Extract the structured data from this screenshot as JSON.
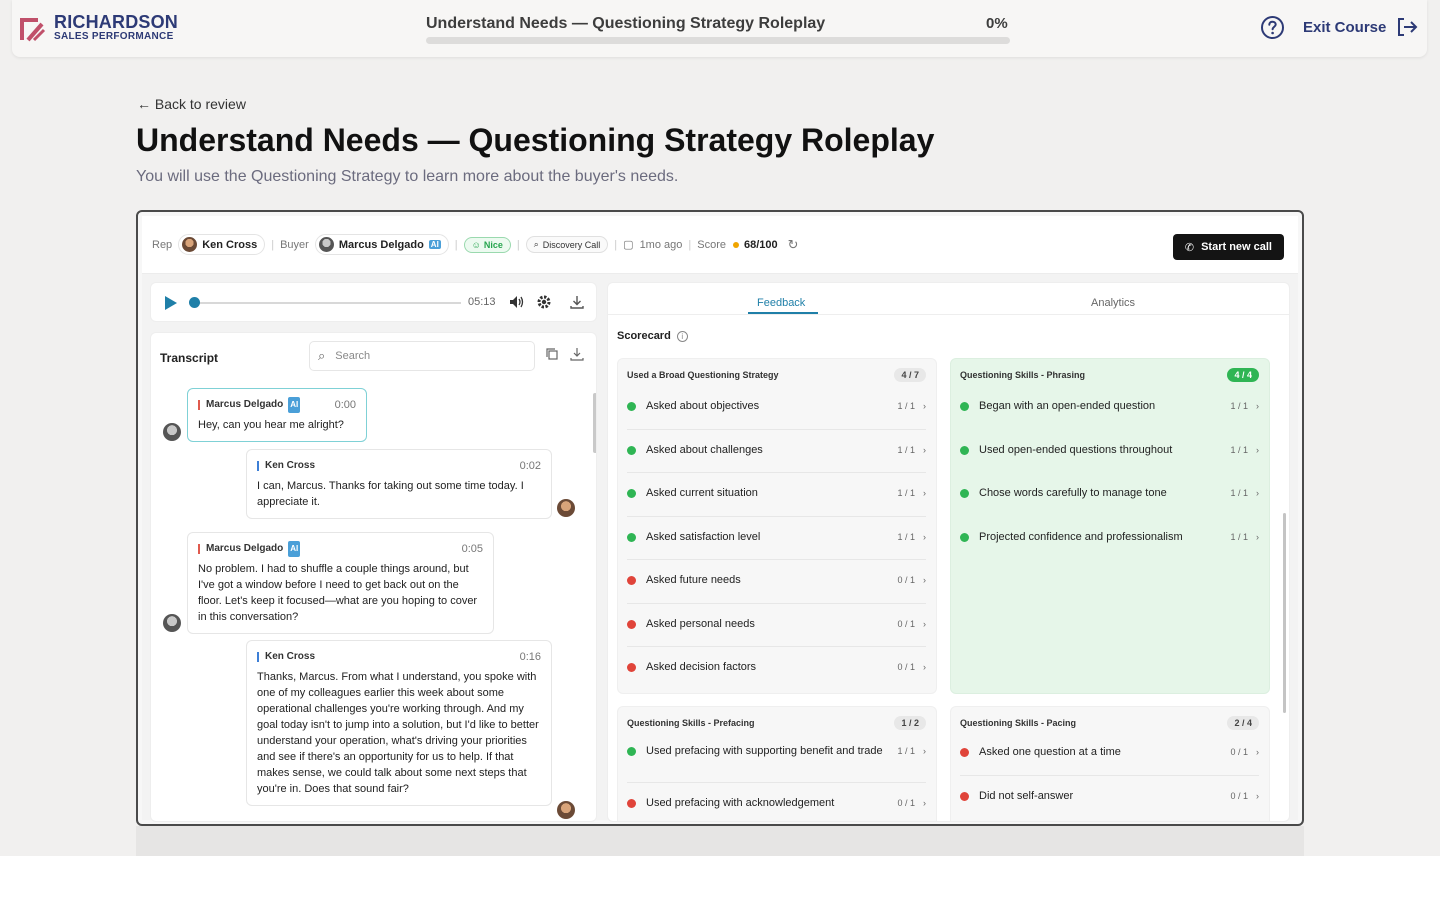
{
  "header": {
    "logo_line1": "RICHARDSON",
    "logo_line2": "SALES PERFORMANCE",
    "course_title": "Understand Needs — Questioning Strategy Roleplay",
    "progress_text": "0%",
    "progress_value": 0,
    "help_icon": "question-circle-icon",
    "exit_label": "Exit Course"
  },
  "page": {
    "back_label": "← Back to review",
    "title": "Understand Needs — Questioning Strategy Roleplay",
    "subtitle": "You will use the Questioning Strategy to learn more about the buyer's needs."
  },
  "callbar": {
    "rep_label": "Rep",
    "rep_name": "Ken Cross",
    "buyer_label": "Buyer",
    "buyer_name": "Marcus Delgado",
    "ai_badge": "AI",
    "nice_label": "Nice",
    "call_type": "Discovery Call",
    "time_ago": "1mo ago",
    "score_label": "Score",
    "score_value": "68/100",
    "start_label": "Start new call"
  },
  "player": {
    "duration": "05:13"
  },
  "transcript": {
    "title": "Transcript",
    "search_placeholder": "Search",
    "messages": [
      {
        "speaker": "Marcus Delgado",
        "ai": "AI",
        "time": "0:00",
        "text": "Hey, can you hear me alright?"
      },
      {
        "speaker": "Ken Cross",
        "time": "0:02",
        "text": "I can, Marcus. Thanks for taking out some time today. I appreciate it."
      },
      {
        "speaker": "Marcus Delgado",
        "ai": "AI",
        "time": "0:05",
        "text": "No problem. I had to shuffle a couple things around, but I've got a window before I need to get back out on the floor. Let's keep it focused—what are you hoping to cover in this conversation?"
      },
      {
        "speaker": "Ken Cross",
        "time": "0:16",
        "text": "Thanks, Marcus. From what I understand, you spoke with one of my colleagues earlier this week about some operational challenges you're working through. And my goal today isn't to jump into a solution, but I'd like to better understand your operation, what's driving your priorities and see if there's an opportunity for us to help. If that makes sense, we could talk about some next steps that you're in. Does that sound fair?"
      }
    ]
  },
  "feedback": {
    "tab_feedback": "Feedback",
    "tab_analytics": "Analytics",
    "scorecard_label": "Scorecard",
    "cards": [
      {
        "title": "Used a Broad Questioning Strategy",
        "score": "4 / 7",
        "items": [
          {
            "label": "Asked about objectives",
            "score": "1 / 1",
            "status": "pass"
          },
          {
            "label": "Asked about challenges",
            "score": "1 / 1",
            "status": "pass"
          },
          {
            "label": "Asked current situation",
            "score": "1 / 1",
            "status": "pass"
          },
          {
            "label": "Asked satisfaction level",
            "score": "1 / 1",
            "status": "pass"
          },
          {
            "label": "Asked future needs",
            "score": "0 / 1",
            "status": "fail"
          },
          {
            "label": "Asked personal needs",
            "score": "0 / 1",
            "status": "fail"
          },
          {
            "label": "Asked decision factors",
            "score": "0 / 1",
            "status": "fail"
          }
        ]
      },
      {
        "title": "Questioning Skills - Phrasing",
        "score": "4 / 4",
        "items": [
          {
            "label": "Began with an open-ended question",
            "score": "1 / 1",
            "status": "pass"
          },
          {
            "label": "Used open-ended questions throughout",
            "score": "1 / 1",
            "status": "pass"
          },
          {
            "label": "Chose words carefully to manage tone",
            "score": "1 / 1",
            "status": "pass"
          },
          {
            "label": "Projected confidence and professionalism",
            "score": "1 / 1",
            "status": "pass"
          }
        ]
      },
      {
        "title": "Questioning Skills - Prefacing",
        "score": "1 / 2",
        "items": [
          {
            "label": "Used prefacing with supporting benefit and trade",
            "score": "1 / 1",
            "status": "pass"
          },
          {
            "label": "Used prefacing with acknowledgement",
            "score": "0 / 1",
            "status": "fail"
          }
        ]
      },
      {
        "title": "Questioning Skills - Pacing",
        "score": "2 / 4",
        "items": [
          {
            "label": "Asked one question at a time",
            "score": "0 / 1",
            "status": "fail"
          },
          {
            "label": "Did not self-answer",
            "score": "0 / 1",
            "status": "fail"
          }
        ]
      }
    ]
  },
  "colors": {
    "brand": "#2d3a76",
    "accent": "#1f7fa8",
    "pass": "#2fb554",
    "fail": "#e0443a",
    "score_dot": "#f0a500"
  }
}
